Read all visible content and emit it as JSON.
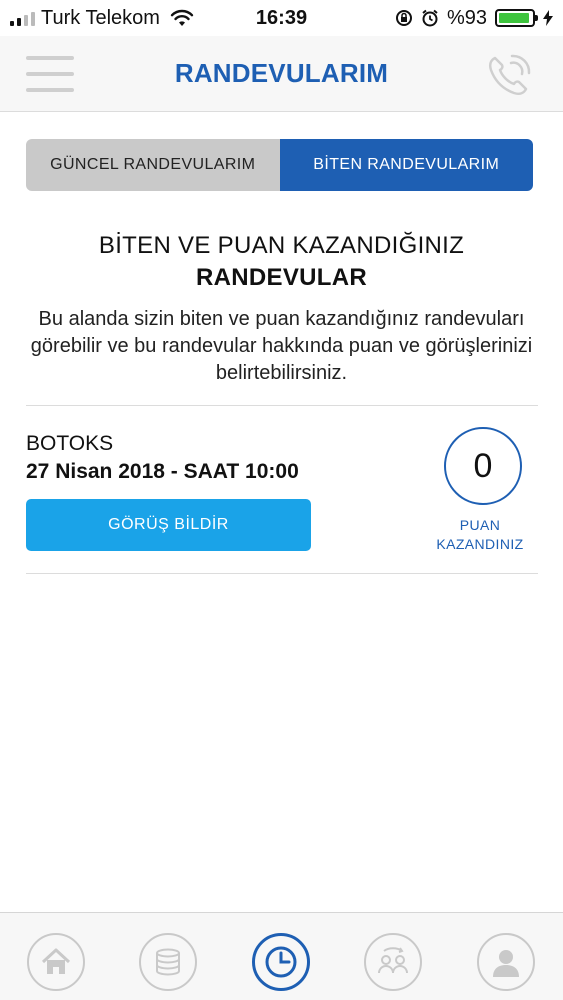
{
  "status_bar": {
    "carrier": "Turk Telekom",
    "time": "16:39",
    "battery_text": "%93",
    "battery_level": 0.93,
    "battery_color": "#3ec43e"
  },
  "header": {
    "title": "RANDEVULARIM",
    "menu_icon": "hamburger-icon",
    "phone_icon": "phone-icon"
  },
  "tabs": [
    {
      "label": "GÜNCEL RANDEVULARIM",
      "active": false
    },
    {
      "label": "BİTEN RANDEVULARIM",
      "active": true
    }
  ],
  "intro": {
    "heading_line1": "BİTEN VE PUAN KAZANDIĞINIZ",
    "heading_line2": "RANDEVULAR",
    "description": "Bu alanda sizin biten ve puan kazandığınız randevuları görebilir ve bu randevular hakkında puan ve görüşlerinizi belirtebilirsiniz."
  },
  "appointment": {
    "service": "BOTOKS",
    "datetime": "27 Nisan 2018 - SAAT 10:00",
    "feedback_button": "GÖRÜŞ BİLDİR",
    "points": "0",
    "points_label_1": "PUAN",
    "points_label_2": "KAZANDINIZ"
  },
  "bottom_nav": [
    {
      "icon": "home-icon",
      "active": false
    },
    {
      "icon": "coins-icon",
      "active": false
    },
    {
      "icon": "clock-icon",
      "active": true
    },
    {
      "icon": "people-exchange-icon",
      "active": false
    },
    {
      "icon": "profile-icon",
      "active": false
    }
  ],
  "colors": {
    "brand_blue": "#1e5fb3",
    "button_blue": "#1aa3e8",
    "inactive_tab": "#c9c9c9",
    "nav_inactive": "#c9c9c9"
  }
}
